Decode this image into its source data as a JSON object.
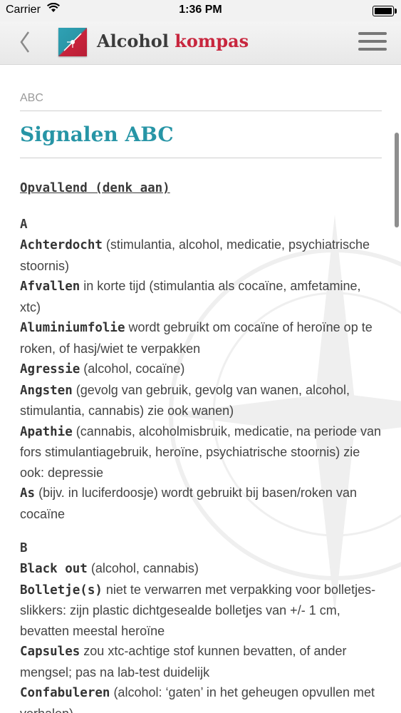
{
  "status": {
    "carrier": "Carrier",
    "time": "1:36 PM",
    "battery_level": 1.0
  },
  "app": {
    "brand_part1": "Alcohol",
    "brand_part2": "kompas",
    "accent": "#2795a6",
    "brand_red": "#c8263e"
  },
  "nav": {
    "back_icon": "chevron-left-icon",
    "menu_icon": "hamburger-menu-icon"
  },
  "breadcrumb": "ABC",
  "page_title": "Signalen ABC",
  "section_title": "Opvallend (denk aan)",
  "groups": [
    {
      "letter": "A",
      "entries": [
        {
          "term": "Achterdocht",
          "text": " (stimulantia, alcohol, medicatie, psychiatrische stoornis)"
        },
        {
          "term": "Afvallen",
          "text": " in korte tijd (stimulantia als cocaïne, amfetamine, xtc)"
        },
        {
          "term": "Aluminiumfolie",
          "text": " wordt gebruikt om cocaïne of heroïne op te roken, of hasj/wiet te verpakken"
        },
        {
          "term": "Agressie",
          "text": " (alcohol, cocaïne)"
        },
        {
          "term": "Angsten",
          "text": " (gevolg van gebruik, gevolg van wanen, alcohol, stimulantia, cannabis) zie ook wanen)"
        },
        {
          "term": "Apathie",
          "text": " (cannabis, alcoholmisbruik, medicatie, na periode van fors stimulantiagebruik, heroïne, psychiatrische stoornis) zie ook: depressie"
        },
        {
          "term": "As",
          "text": " (bijv. in luciferdoosje) wordt gebruikt bij basen/roken van cocaïne"
        }
      ]
    },
    {
      "letter": "B",
      "entries": [
        {
          "term": "Black out",
          "text": " (alcohol, cannabis)"
        },
        {
          "term": "Bolletje(s)",
          "text": " niet te verwarren met verpakking voor bolletjes-slikkers: zijn plastic dichtgesealde bolletjes van +/- 1 cm, bevatten meestal heroïne"
        },
        {
          "term": "Capsules",
          "text": " zou xtc-achtige stof kunnen bevatten, of ander mengsel; pas na lab-test duidelijk"
        },
        {
          "term": "Confabuleren",
          "text": " (alcohol: ‘gaten’ in het geheugen opvullen met verhalen)"
        }
      ]
    }
  ]
}
